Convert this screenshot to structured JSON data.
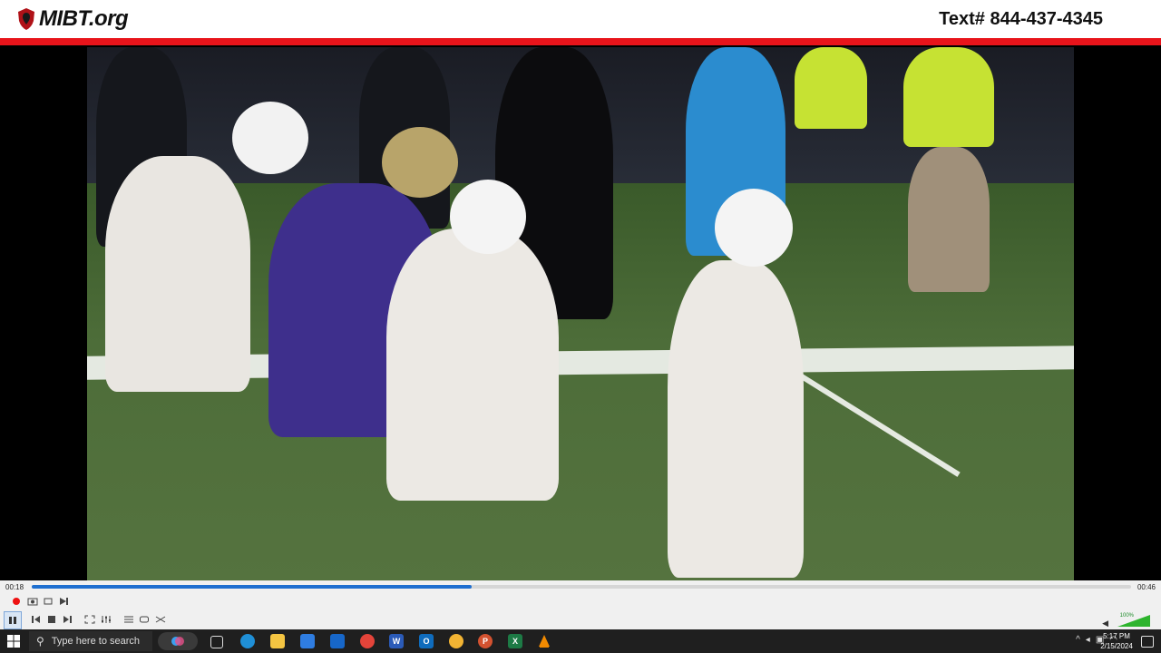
{
  "header": {
    "logo_text": "MIBT.org",
    "text_line": "Text# 844-437-4345"
  },
  "player": {
    "current_time": "00:18",
    "total_time": "00:46",
    "progress": 0.4,
    "volume_label": "100%",
    "volume_level": 1.0
  },
  "controls": {
    "record": "record-icon",
    "snapshot": "camera-icon",
    "loop_ab": "loop-ab-icon",
    "frame_step": "frame-step-icon",
    "pause": "pause-icon",
    "prev": "previous-icon",
    "stop": "stop-icon",
    "next": "next-icon",
    "fullscreen": "fullscreen-icon",
    "extended": "extended-settings-icon",
    "playlist": "playlist-icon",
    "loop": "loop-icon",
    "shuffle": "shuffle-icon"
  },
  "taskbar": {
    "search_placeholder": "Type here to search",
    "time": "5:17 PM",
    "date": "2/15/2024",
    "apps": [
      "task-view",
      "edge",
      "file-explorer",
      "store",
      "mail",
      "chrome",
      "word",
      "outlook",
      "chrome-2",
      "powerpoint",
      "excel",
      "vlc"
    ]
  },
  "colors": {
    "brand_red": "#e8141b",
    "progress_blue": "#1e6fd0",
    "volume_green": "#2db42d"
  }
}
